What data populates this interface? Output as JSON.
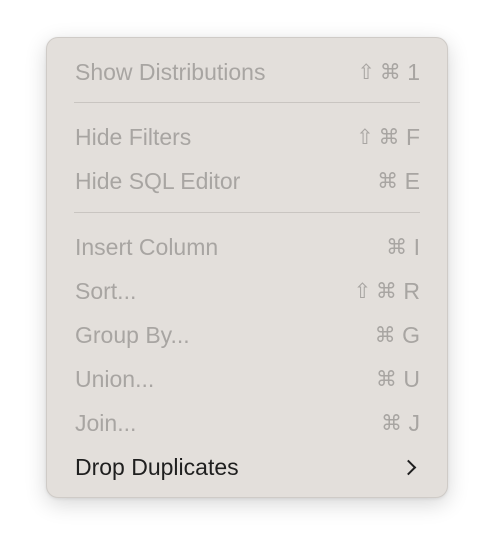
{
  "menu": {
    "items": [
      {
        "label": "Show Distributions",
        "shift": "⇧",
        "cmd": "⌘",
        "key": "1",
        "enabled": false
      },
      {
        "label": "Hide Filters",
        "shift": "⇧",
        "cmd": "⌘",
        "key": "F",
        "enabled": false
      },
      {
        "label": "Hide SQL Editor",
        "shift": "",
        "cmd": "⌘",
        "key": "E",
        "enabled": false
      },
      {
        "label": "Insert Column",
        "shift": "",
        "cmd": "⌘",
        "key": "I",
        "enabled": false
      },
      {
        "label": "Sort...",
        "shift": "⇧",
        "cmd": "⌘",
        "key": "R",
        "enabled": false
      },
      {
        "label": "Group By...",
        "shift": "",
        "cmd": "⌘",
        "key": "G",
        "enabled": false
      },
      {
        "label": "Union...",
        "shift": "",
        "cmd": "⌘",
        "key": "U",
        "enabled": false
      },
      {
        "label": "Join...",
        "shift": "",
        "cmd": "⌘",
        "key": "J",
        "enabled": false
      },
      {
        "label": "Drop Duplicates",
        "shift": "",
        "cmd": "",
        "key": "",
        "enabled": true,
        "submenu_icon": "chevron-right-icon"
      }
    ]
  },
  "colors": {
    "menu_background": "#e3dfdb",
    "disabled_text": "#a8a5a2",
    "enabled_text": "#1f1f1f",
    "separator": "#c9c5c1"
  }
}
